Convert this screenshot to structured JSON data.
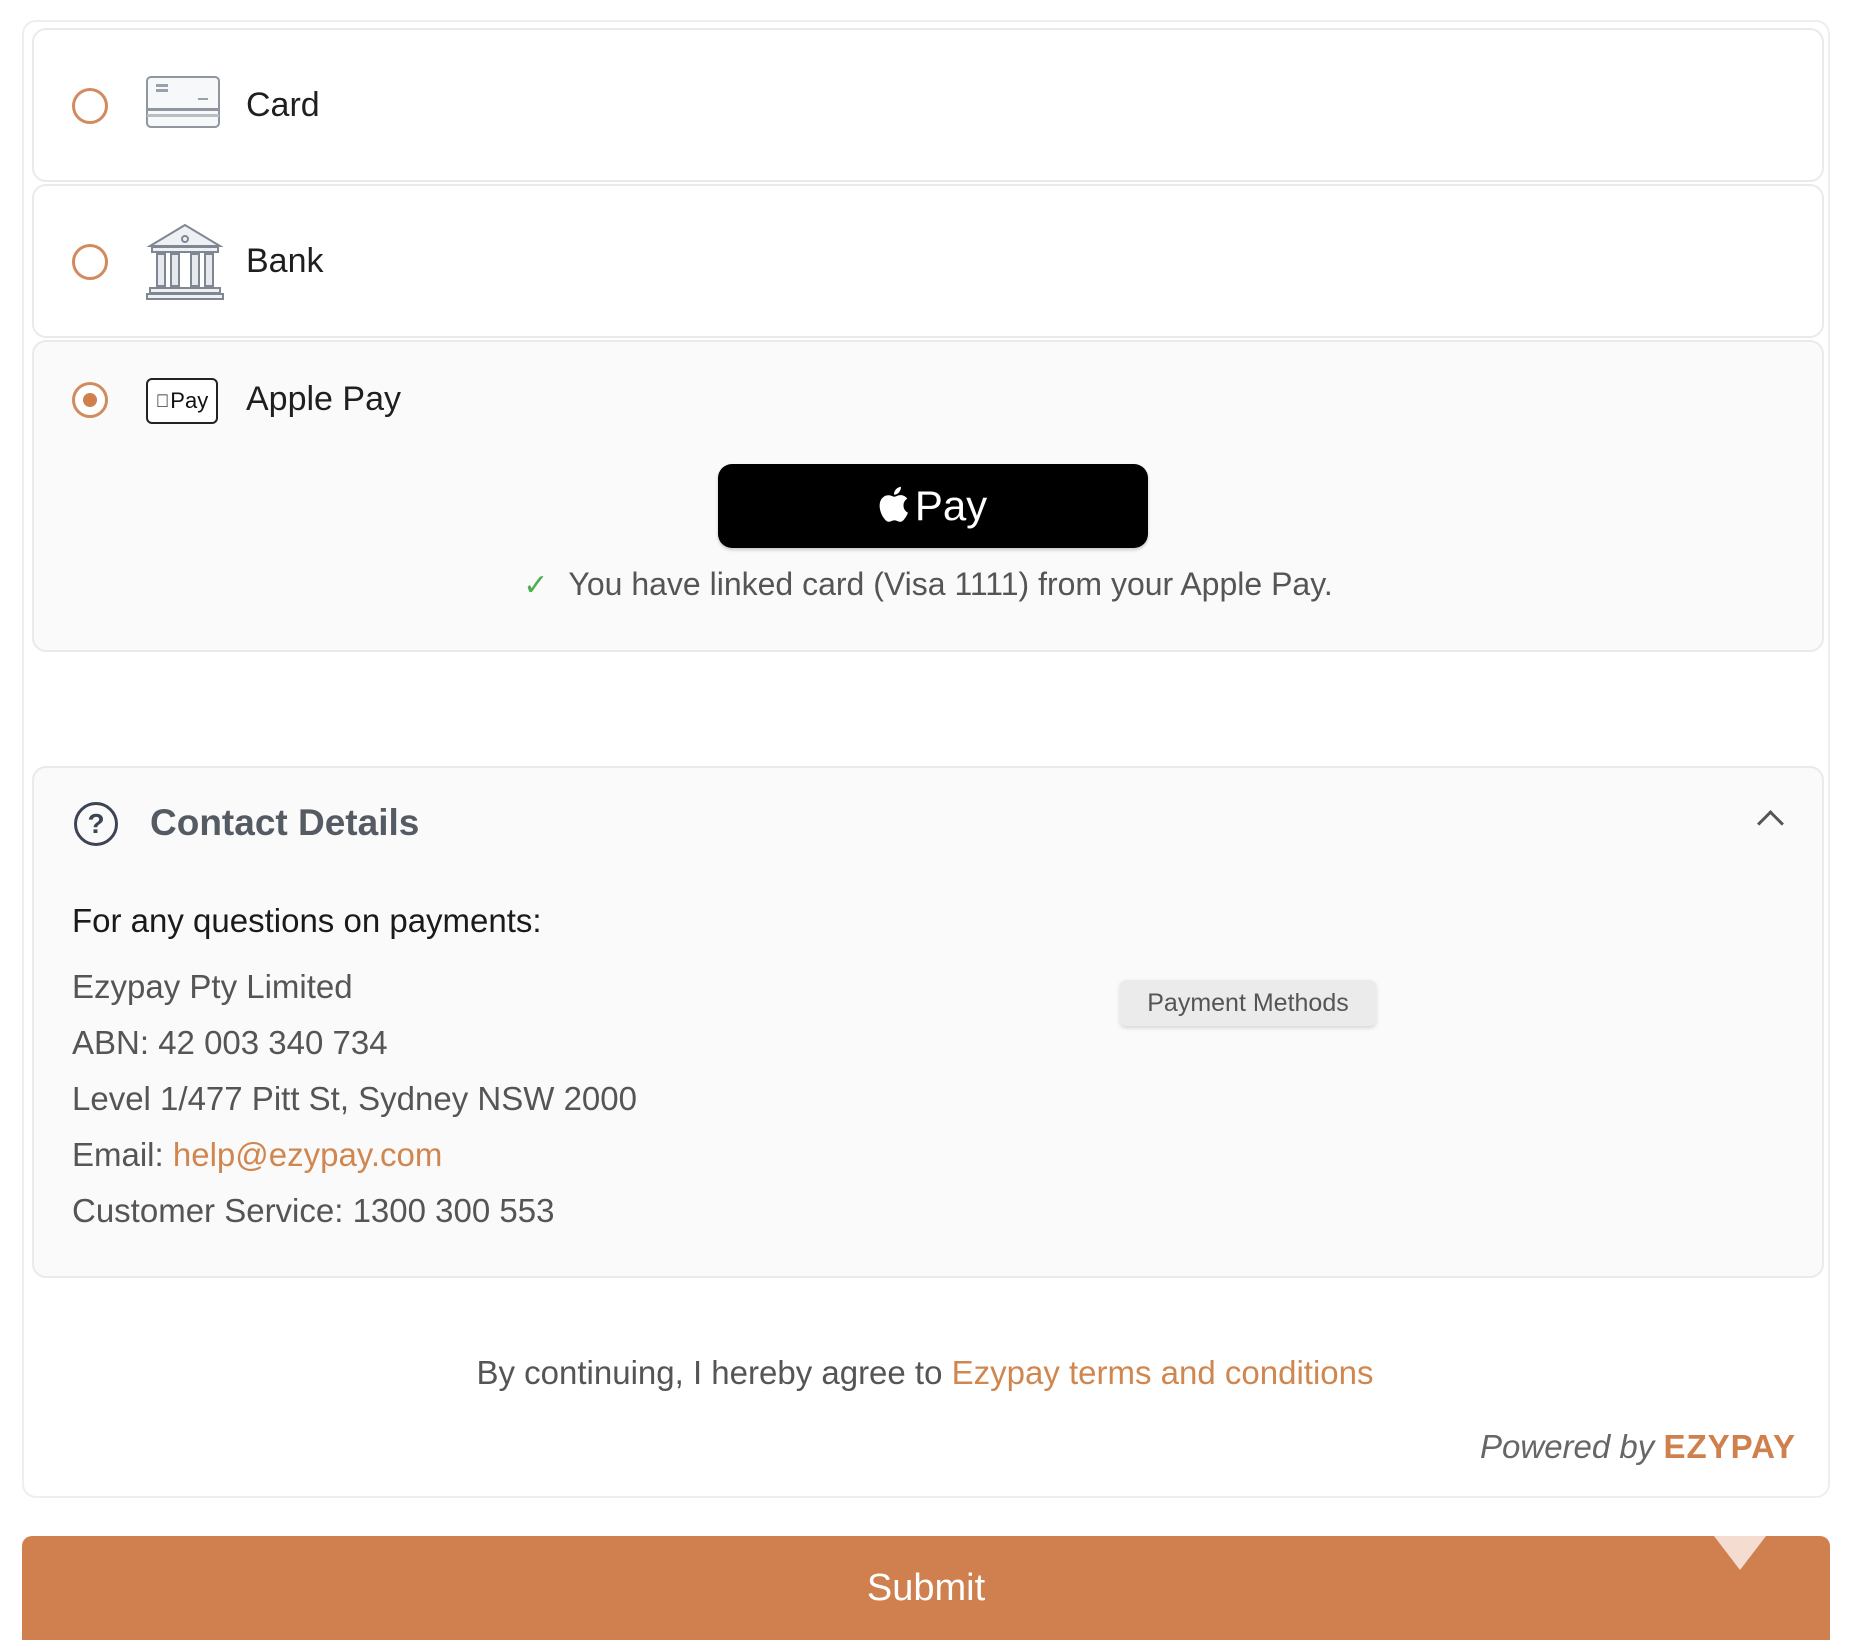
{
  "payment_options": [
    {
      "label": "Card",
      "icon": "credit-card-icon",
      "selected": false
    },
    {
      "label": "Bank",
      "icon": "bank-icon",
      "selected": false
    },
    {
      "label": "Apple Pay",
      "icon": "apple-pay-icon",
      "selected": true,
      "badge_text": "Pay"
    }
  ],
  "apple_pay": {
    "button_text": "Pay",
    "linked_message": "You have linked card (Visa 1111) from your Apple Pay."
  },
  "contact": {
    "title": "Contact Details",
    "heading": "For any questions on payments:",
    "company": "Ezypay Pty Limited",
    "abn": "ABN: 42 003 340 734",
    "address": "Level 1/477 Pitt St, Sydney NSW 2000",
    "email_label": "Email: ",
    "email": "help@ezypay.com",
    "customer_service": "Customer Service: 1300 300 553"
  },
  "tooltip": "Payment Methods",
  "agreement": {
    "prefix": "By continuing, I hereby agree to ",
    "link": "Ezypay terms and conditions"
  },
  "powered_by": {
    "text": "Powered by ",
    "brand": "EZYPAY"
  },
  "submit_label": "Submit",
  "colors": {
    "accent": "#cf804e",
    "link": "#d0874f",
    "check": "#4caf50"
  }
}
